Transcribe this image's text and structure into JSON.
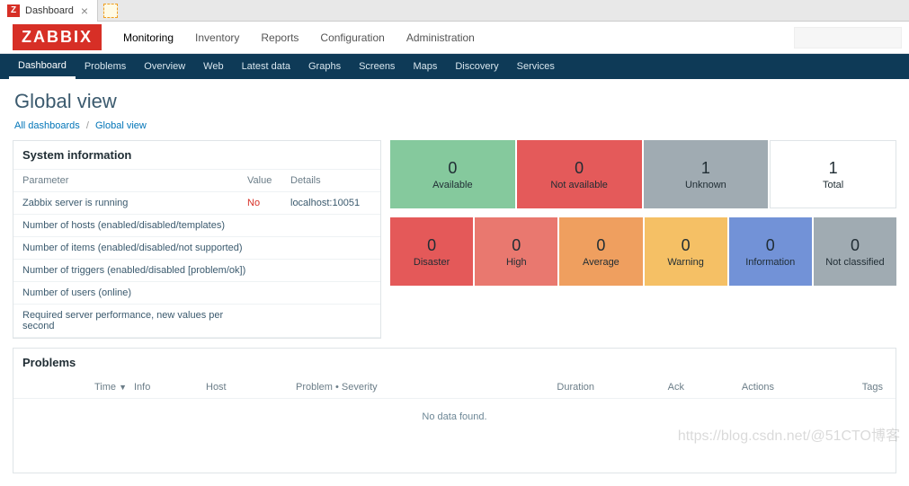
{
  "browser": {
    "tab_title": "Dashboard"
  },
  "logo_text": "ZABBIX",
  "top_nav": [
    "Monitoring",
    "Inventory",
    "Reports",
    "Configuration",
    "Administration"
  ],
  "top_nav_active": "Monitoring",
  "sub_nav": [
    "Dashboard",
    "Problems",
    "Overview",
    "Web",
    "Latest data",
    "Graphs",
    "Screens",
    "Maps",
    "Discovery",
    "Services"
  ],
  "sub_nav_active": "Dashboard",
  "page_title": "Global view",
  "breadcrumb": {
    "root": "All dashboards",
    "current": "Global view"
  },
  "sysinfo": {
    "title": "System information",
    "columns": {
      "param": "Parameter",
      "value": "Value",
      "details": "Details"
    },
    "rows": [
      {
        "param": "Zabbix server is running",
        "value": "No",
        "value_neg": true,
        "details": "localhost:10051"
      },
      {
        "param": "Number of hosts (enabled/disabled/templates)",
        "value": "",
        "details": ""
      },
      {
        "param": "Number of items (enabled/disabled/not supported)",
        "value": "",
        "details": ""
      },
      {
        "param": "Number of triggers (enabled/disabled [problem/ok])",
        "value": "",
        "details": ""
      },
      {
        "param": "Number of users (online)",
        "value": "",
        "details": ""
      },
      {
        "param": "Required server performance, new values per second",
        "value": "",
        "details": ""
      }
    ]
  },
  "host_status": [
    {
      "count": "0",
      "label": "Available",
      "cls": "card-available"
    },
    {
      "count": "0",
      "label": "Not available",
      "cls": "card-notavailable"
    },
    {
      "count": "1",
      "label": "Unknown",
      "cls": "card-unknown"
    },
    {
      "count": "1",
      "label": "Total",
      "cls": "card-total"
    }
  ],
  "severity_status": [
    {
      "count": "0",
      "label": "Disaster",
      "cls": "card-disaster"
    },
    {
      "count": "0",
      "label": "High",
      "cls": "card-high"
    },
    {
      "count": "0",
      "label": "Average",
      "cls": "card-average"
    },
    {
      "count": "0",
      "label": "Warning",
      "cls": "card-warning"
    },
    {
      "count": "0",
      "label": "Information",
      "cls": "card-information"
    },
    {
      "count": "0",
      "label": "Not classified",
      "cls": "card-notclassified"
    }
  ],
  "problems": {
    "title": "Problems",
    "columns": {
      "time": "Time",
      "info": "Info",
      "host": "Host",
      "problem": "Problem • Severity",
      "duration": "Duration",
      "ack": "Ack",
      "actions": "Actions",
      "tags": "Tags"
    },
    "sort_indicator": "▼",
    "no_data": "No data found."
  },
  "watermark": "https://blog.csdn.net/@51CTO博客"
}
